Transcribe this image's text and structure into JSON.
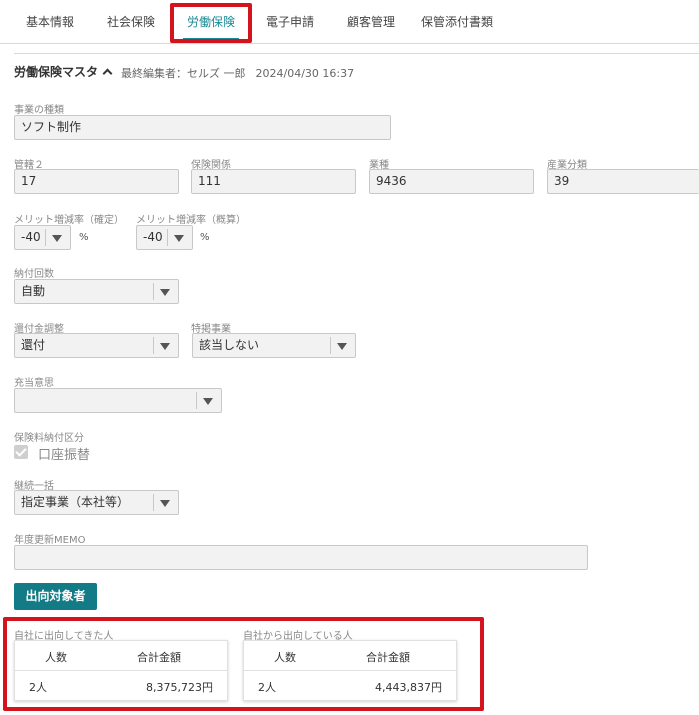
{
  "tabs": [
    {
      "label": "基本情報",
      "active": false
    },
    {
      "label": "社会保険",
      "active": false
    },
    {
      "label": "労働保険",
      "active": true
    },
    {
      "label": "電子申請",
      "active": false
    },
    {
      "label": "顧客管理",
      "active": false
    },
    {
      "label": "保管添付書類",
      "active": false
    }
  ],
  "section": {
    "title": "労働保険マスタ",
    "last_editor": "最終編集者：セルズ 一郎",
    "last_edited": "2024/04/30 16:37"
  },
  "fields": {
    "business_type": {
      "label": "事業の種類",
      "value": "ソフト制作"
    },
    "jurisdiction": {
      "label": "管轄２",
      "value": "17"
    },
    "insurance_relation": {
      "label": "保険関係",
      "value": "111"
    },
    "industry": {
      "label": "業種",
      "value": "9436"
    },
    "industry_class": {
      "label": "産業分類",
      "value": "39"
    },
    "merit_confirmed": {
      "label": "メリット増減率（確定）",
      "value": "-40",
      "unit": "%"
    },
    "merit_estimate": {
      "label": "メリット増減率（概算）",
      "value": "-40",
      "unit": "%"
    },
    "payment_count": {
      "label": "納付回数",
      "value": "自動"
    },
    "refund_adjust": {
      "label": "還付金調整",
      "value": "還付"
    },
    "special_business": {
      "label": "特掲事業",
      "value": "該当しない"
    },
    "allocation_intent": {
      "label": "充当意思",
      "value": ""
    },
    "premium_payment_type": {
      "label": "保険料納付区分",
      "checkbox_label": "口座振替",
      "checked": true
    },
    "continuous_batch": {
      "label": "継続一括",
      "value": "指定事業（本社等）"
    },
    "annual_memo": {
      "label": "年度更新MEMO",
      "value": ""
    }
  },
  "dispatch_button": "出向対象者",
  "dispatch_in": {
    "label": "自社に出向してきた人",
    "headers": [
      "人数",
      "合計金額"
    ],
    "count": "2人",
    "amount": "8,375,723円"
  },
  "dispatch_out": {
    "label": "自社から出向している人",
    "headers": [
      "人数",
      "合計金額"
    ],
    "count": "2人",
    "amount": "4,443,837円"
  },
  "colors": {
    "accent": "#127b86",
    "highlight": "#d4141c"
  }
}
